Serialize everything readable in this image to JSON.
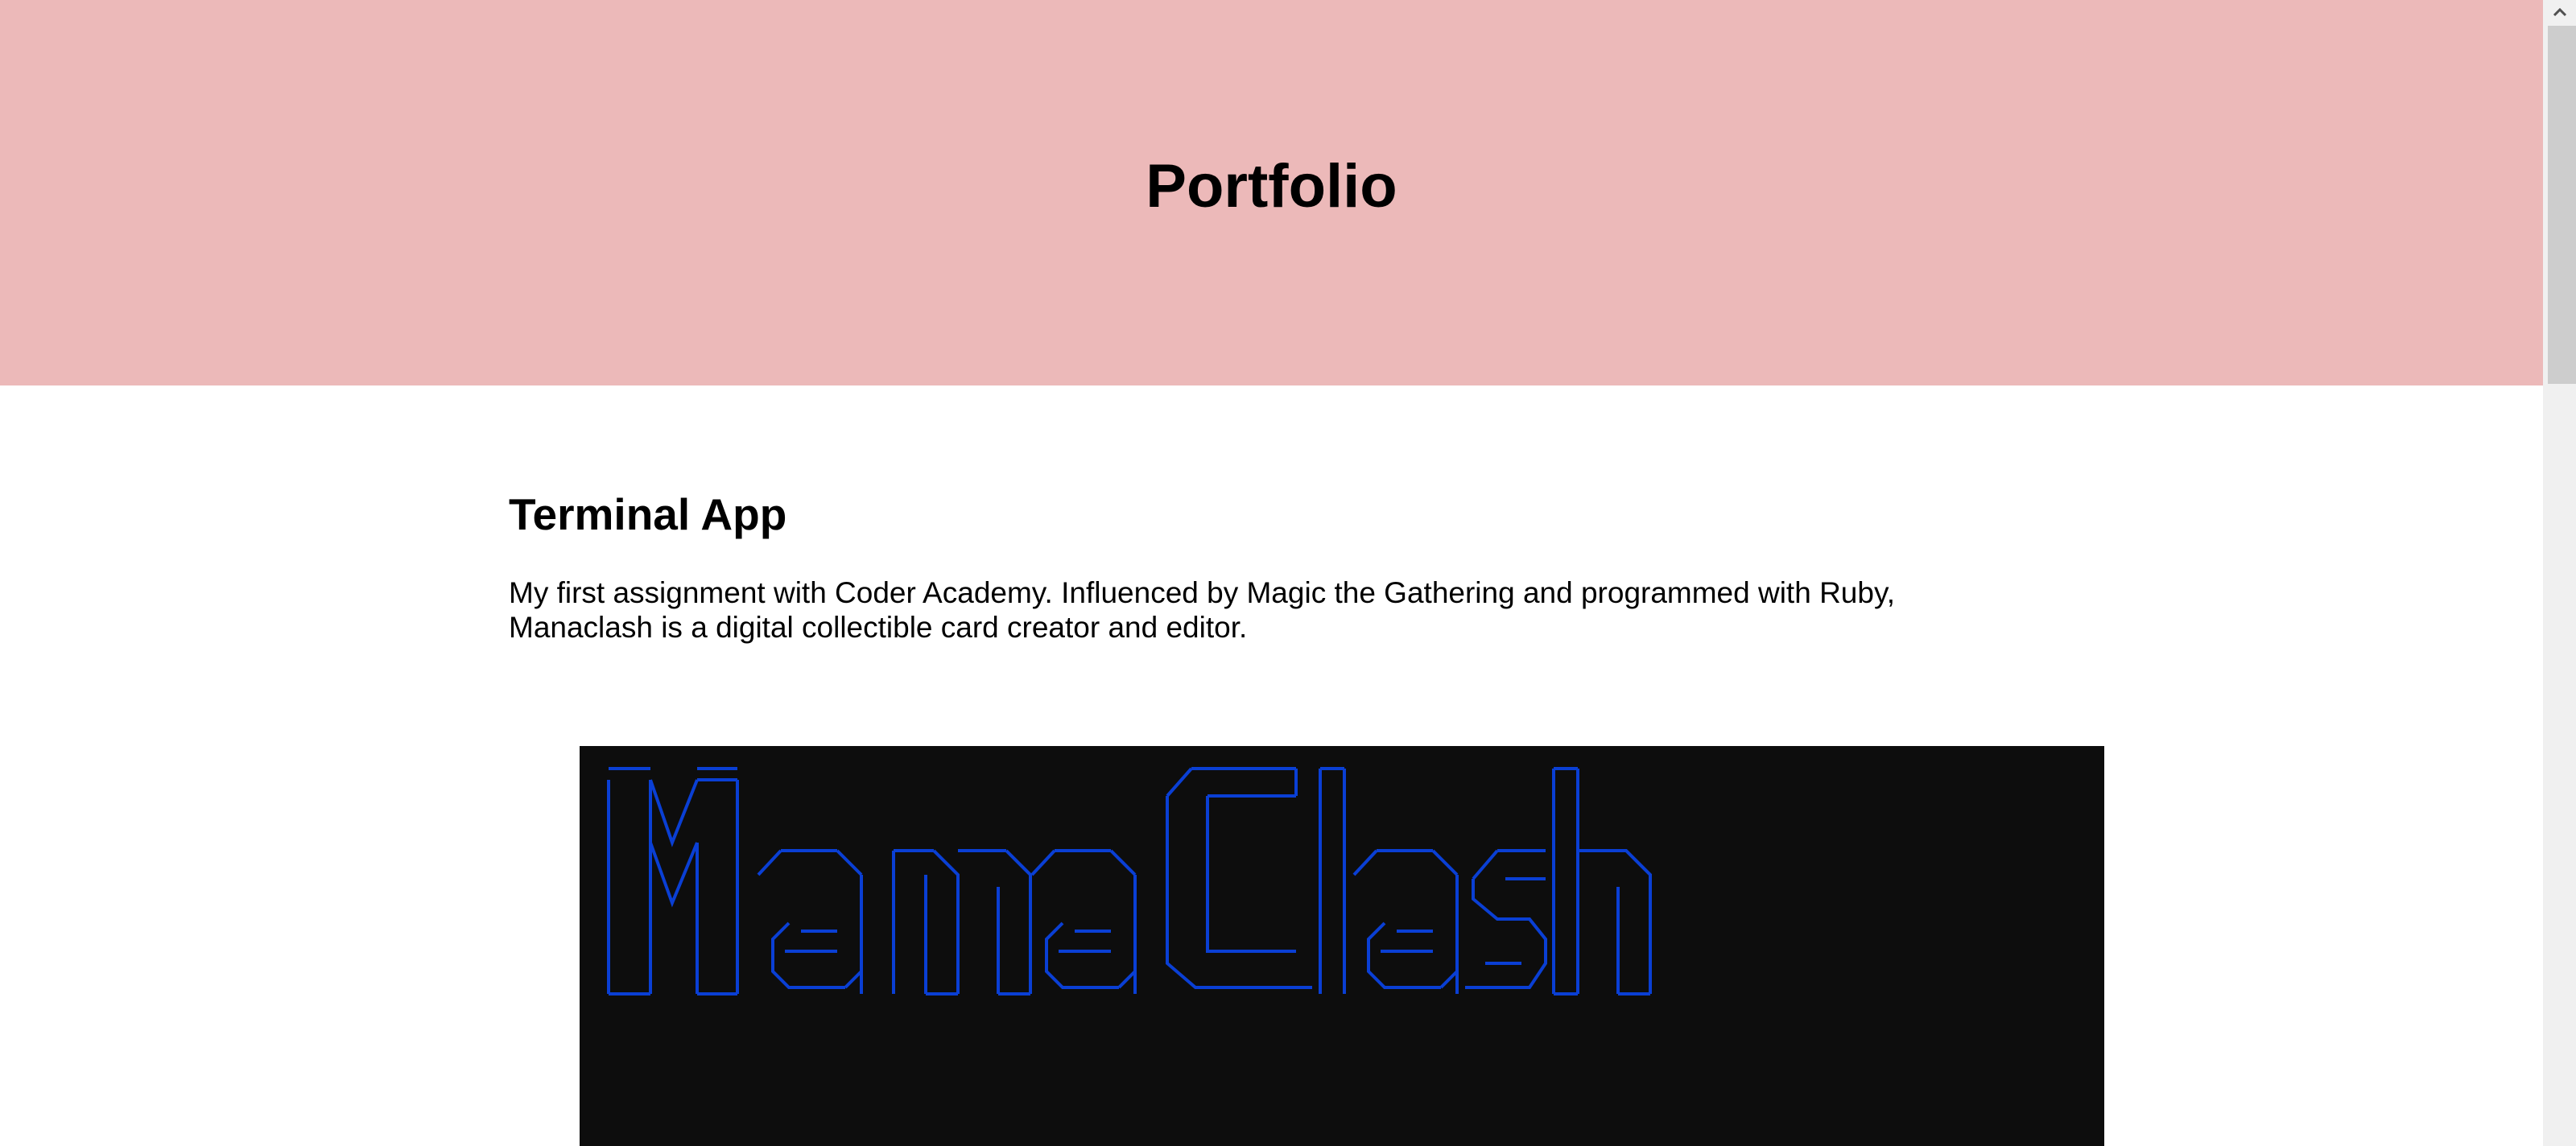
{
  "header": {
    "title": "Portfolio"
  },
  "project": {
    "title": "Terminal App",
    "description": "My first assignment with Coder Academy. Influenced by Magic the Gathering and programmed with Ruby, Manaclash is a digital collectible card creator and editor."
  },
  "terminal": {
    "ascii_art_text": "Mana Clash",
    "text_color": "#0a3fd4",
    "background": "#0d0d0d"
  },
  "colors": {
    "hero_background": "#ecb9b9"
  },
  "scrollbar": {
    "up_icon": "chevron-up-icon"
  }
}
